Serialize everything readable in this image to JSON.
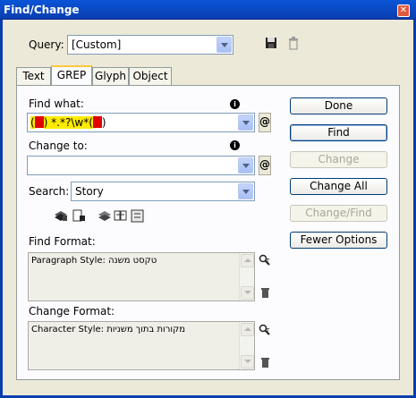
{
  "window": {
    "title": "Find/Change",
    "close_glyph": "✕"
  },
  "query": {
    "label": "Query:",
    "value": "[Custom]"
  },
  "tabs": [
    {
      "label": "Text"
    },
    {
      "label": "GREP"
    },
    {
      "label": "Glyph"
    },
    {
      "label": "Object"
    }
  ],
  "find_what": {
    "label": "Find what:",
    "segments": [
      "(",
      "",
      ") *.*?\\w*(",
      "",
      ")"
    ]
  },
  "change_to": {
    "label": "Change to:",
    "value": ""
  },
  "search": {
    "label": "Search:",
    "value": "Story"
  },
  "find_format": {
    "label": "Find Format:",
    "prefix": "Paragraph Style: ",
    "style_name": "טקסט משנה"
  },
  "change_format": {
    "label": "Change Format:",
    "prefix": "Character Style: ",
    "style_name": "מקורות בתוך משניות"
  },
  "buttons": {
    "done": "Done",
    "find": "Find",
    "change": "Change",
    "change_all": "Change All",
    "change_find": "Change/Find",
    "fewer_options": "Fewer Options"
  },
  "icons": {
    "save_query": "save-icon",
    "delete_query": "trash-icon",
    "info": "i",
    "special_char": "@"
  },
  "colors": {
    "titlebar": "#0a3eaf",
    "highlight_yellow": "#ffeb00",
    "highlight_red": "#e30000"
  }
}
